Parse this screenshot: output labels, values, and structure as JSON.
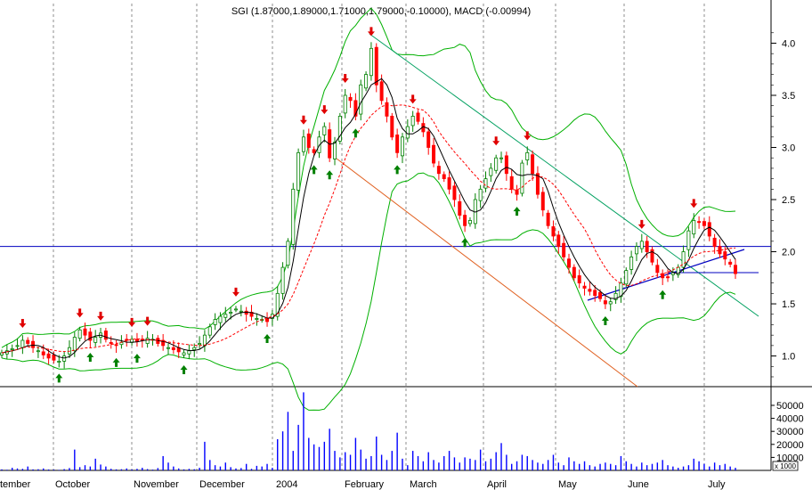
{
  "chart_data": {
    "type": "candlestick",
    "title": "SGI (1.87000,1.89000,1.71000,1.79000,-0.10000), MACD (-0.00994)",
    "price_axis": {
      "ylim": [
        0.74,
        4.38
      ],
      "ticks": [
        1.0,
        1.5,
        2.0,
        2.5,
        3.0,
        3.5,
        4.0
      ],
      "tick_labels": [
        "1.0",
        "1.5",
        "2.0",
        "2.5",
        "3.0",
        "3.5",
        "4.0"
      ]
    },
    "volume_axis": {
      "ylim": [
        0,
        63000
      ],
      "ticks": [
        10000,
        20000,
        30000,
        40000,
        50000
      ],
      "tick_labels": [
        "10000",
        "20000",
        "30000",
        "40000",
        "50000"
      ],
      "multiplier_label": "x 1000"
    },
    "months": [
      "tember",
      "October",
      "November",
      "December",
      "2004",
      "February",
      "March",
      "April",
      "May",
      "June",
      "July"
    ],
    "closes": [
      1.03,
      1.05,
      1.07,
      1.1,
      1.15,
      1.12,
      1.08,
      1.05,
      1.01,
      0.98,
      0.96,
      0.95,
      1.0,
      1.08,
      1.18,
      1.25,
      1.2,
      1.15,
      1.18,
      1.22,
      1.16,
      1.12,
      1.1,
      1.13,
      1.15,
      1.16,
      1.14,
      1.15,
      1.17,
      1.16,
      1.12,
      1.1,
      1.08,
      1.06,
      1.04,
      1.03,
      1.05,
      1.08,
      1.12,
      1.2,
      1.28,
      1.35,
      1.38,
      1.4,
      1.42,
      1.45,
      1.43,
      1.4,
      1.38,
      1.36,
      1.35,
      1.33,
      1.4,
      1.6,
      1.85,
      2.1,
      2.6,
      2.95,
      3.1,
      3.0,
      2.95,
      3.1,
      3.2,
      2.9,
      3.05,
      3.3,
      3.5,
      3.45,
      3.3,
      3.6,
      3.7,
      3.95,
      3.6,
      3.45,
      3.3,
      3.1,
      2.95,
      3.1,
      3.2,
      3.3,
      3.25,
      3.15,
      3.0,
      2.85,
      2.75,
      2.7,
      2.6,
      2.5,
      2.35,
      2.25,
      2.3,
      2.5,
      2.6,
      2.7,
      2.8,
      2.9,
      2.9,
      2.75,
      2.6,
      2.55,
      2.85,
      2.95,
      2.75,
      2.55,
      2.4,
      2.25,
      2.15,
      2.05,
      1.95,
      1.85,
      1.75,
      1.7,
      1.65,
      1.62,
      1.58,
      1.55,
      1.5,
      1.52,
      1.6,
      1.7,
      1.82,
      1.95,
      2.05,
      2.1,
      2.0,
      1.9,
      1.8,
      1.75,
      1.75,
      1.8,
      1.85,
      2.0,
      2.2,
      2.3,
      2.28,
      2.25,
      2.15,
      2.05,
      1.98,
      1.93,
      1.88,
      1.79
    ],
    "volume": [
      800,
      500,
      2000,
      1500,
      1200,
      3000,
      800,
      900,
      1500,
      700,
      600,
      400,
      1000,
      1800,
      16000,
      2500,
      4000,
      3000,
      9000,
      4500,
      3000,
      1200,
      800,
      900,
      1500,
      700,
      1200,
      2000,
      1000,
      600,
      1800,
      11000,
      6000,
      3000,
      1500,
      800,
      1200,
      900,
      2000,
      22000,
      8000,
      4000,
      3000,
      6000,
      2500,
      1500,
      1800,
      5000,
      1200,
      3500,
      3000,
      5000,
      2000,
      24000,
      30000,
      45000,
      15000,
      35000,
      60000,
      25000,
      20000,
      18000,
      22000,
      32000,
      15000,
      10000,
      14000,
      12000,
      25000,
      16000,
      9000,
      11000,
      26000,
      12000,
      8000,
      15000,
      29000,
      9000,
      4000,
      15000,
      11000,
      7000,
      14000,
      8000,
      6000,
      11000,
      15000,
      10000,
      6000,
      10000,
      9000,
      8000,
      16000,
      7000,
      9000,
      14000,
      21000,
      12000,
      5000,
      7000,
      12000,
      11000,
      8000,
      6000,
      5000,
      8000,
      12000,
      6000,
      4000,
      10000,
      7000,
      5000,
      7000,
      4000,
      3000,
      5000,
      6000,
      5000,
      4000,
      11000,
      7000,
      5000,
      3000,
      6000,
      4000,
      5000,
      6000,
      8000,
      4000,
      3000,
      2000,
      3000,
      4000,
      9000,
      7000,
      5000,
      3000,
      6000,
      4000,
      5000,
      3000,
      2000
    ],
    "overlays": {
      "sma": "black line",
      "ema": "red dashed line",
      "bollinger": "green lines"
    },
    "signals": {
      "buy_count": 28,
      "sell_count": 27
    },
    "horizontal_line_level": 2.05,
    "colors": {
      "up": "#008000",
      "down": "#ff0000",
      "sma": "#000000",
      "ema": "#ff0000",
      "band": "#00b000",
      "hline": "#0000c0",
      "volume": "#0000ff",
      "grid": "#606060"
    }
  }
}
